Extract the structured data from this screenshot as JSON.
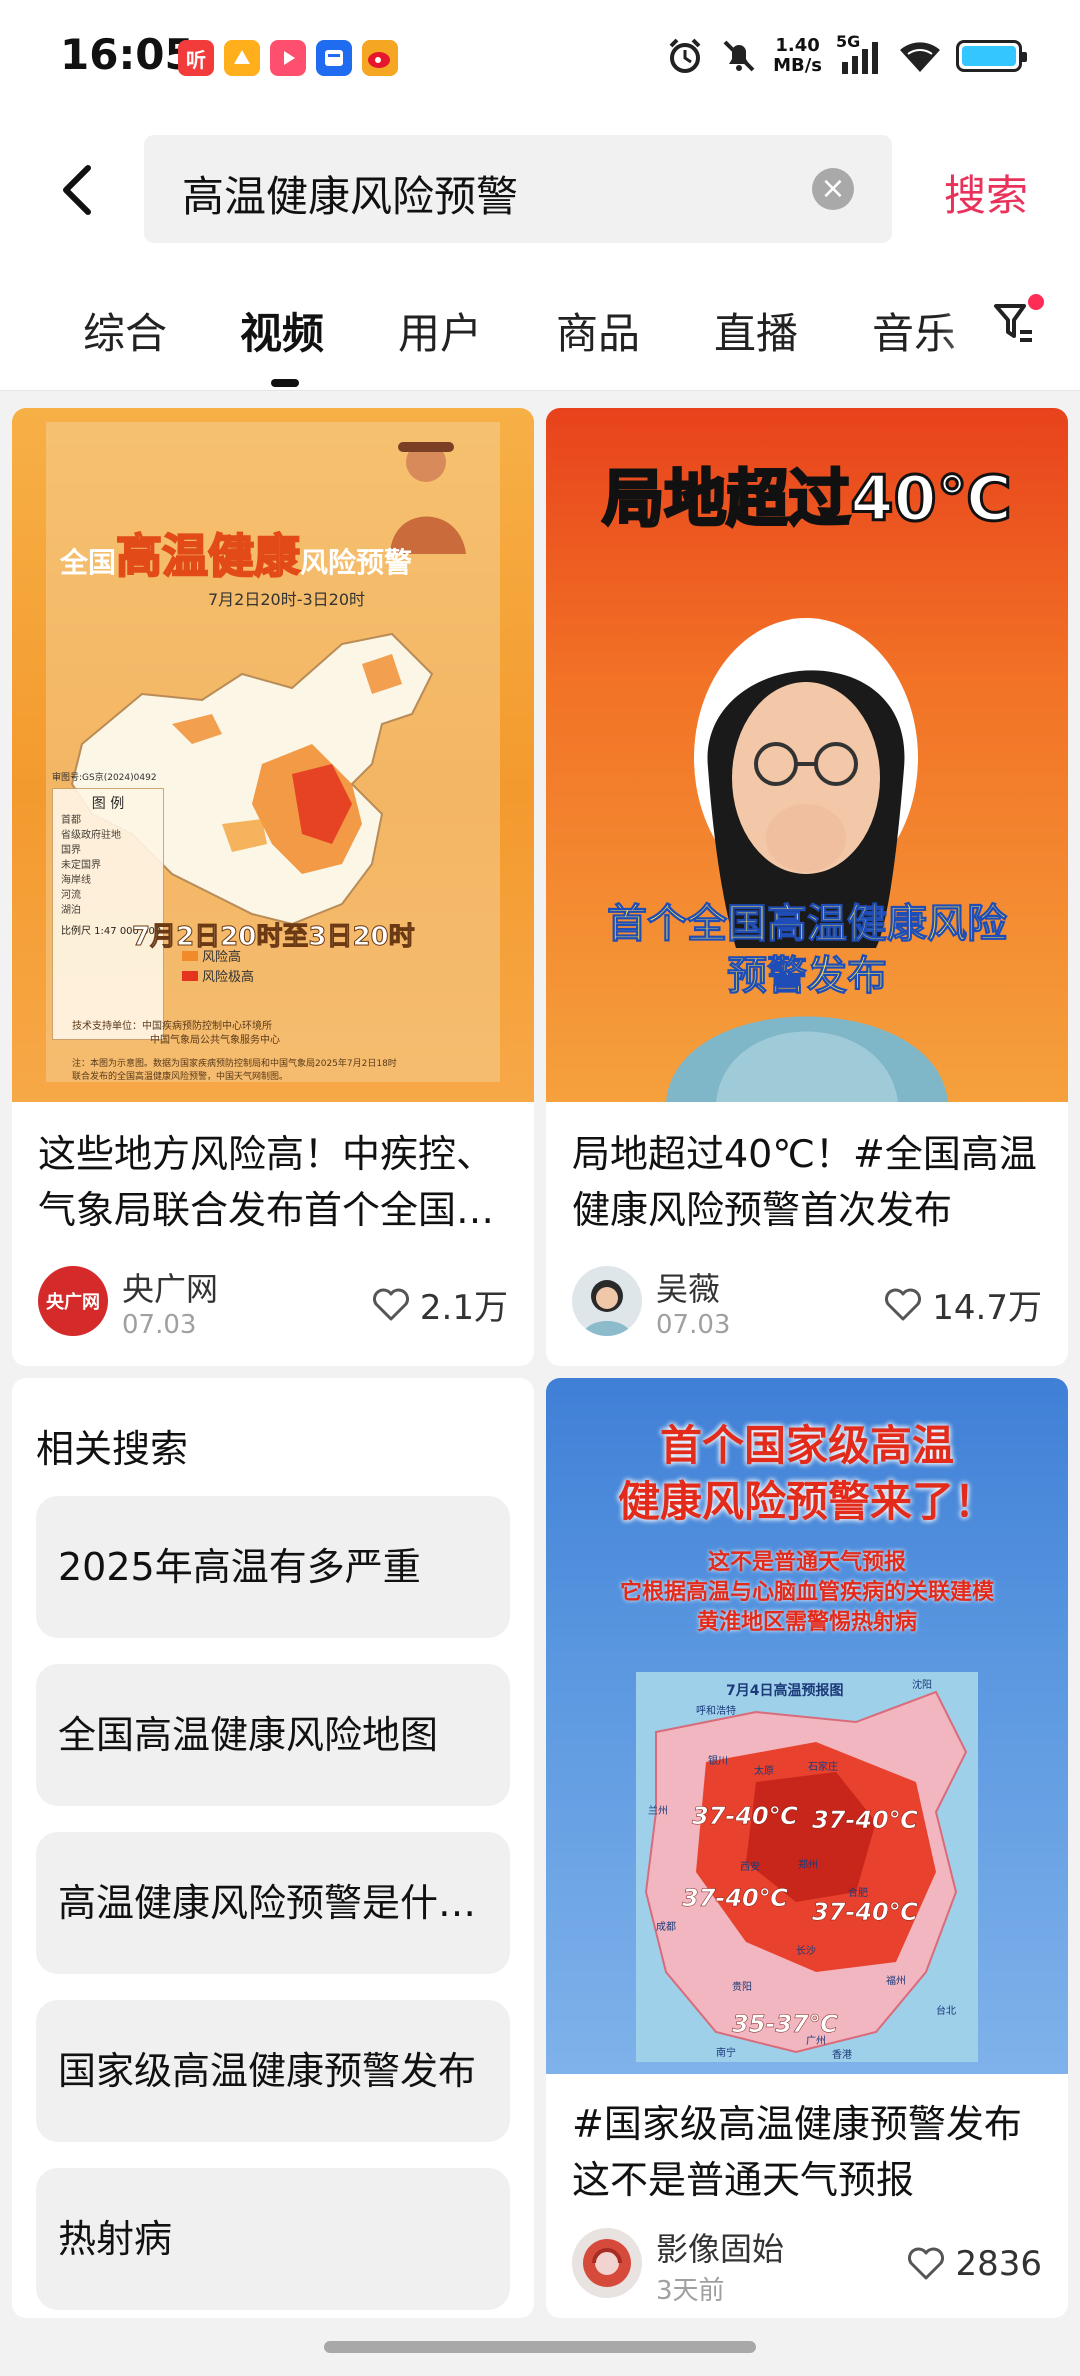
{
  "status_bar": {
    "time": "16:05",
    "apps": [
      {
        "icon": "ting-app-icon",
        "label": "听",
        "color": "#f23c3c"
      },
      {
        "icon": "orange-app-icon",
        "label": "",
        "color": "#ffae1c"
      },
      {
        "icon": "video-app-icon",
        "label": "",
        "color": "#ff4f6e"
      },
      {
        "icon": "news-app-icon",
        "label": "",
        "color": "#1f6cf0"
      },
      {
        "icon": "weibo-icon",
        "label": "",
        "color": "#f5a623"
      }
    ],
    "net_speed_value": "1.40",
    "net_speed_unit": "MB/s",
    "signal_label": "5G"
  },
  "search": {
    "query": "高温健康风险预警",
    "button_label": "搜索"
  },
  "tabs": [
    {
      "label": "综合"
    },
    {
      "label": "视频"
    },
    {
      "label": "用户"
    },
    {
      "label": "商品"
    },
    {
      "label": "直播"
    },
    {
      "label": "音乐"
    }
  ],
  "cards": [
    {
      "title": "这些地方风险高！中疾控、气象局联合发布首个全国高温健康风险预警",
      "author": "央广网",
      "avatar_text": "央广网",
      "date": "07.03",
      "likes": "2.1万",
      "thumb": {
        "heading_a": "全国",
        "heading_b": "高温健康",
        "heading_c": "风险预警",
        "time_range": "7月2日20时-3日20时",
        "map_caption": "7月2日20时至3日20时",
        "legend_title": "图 例",
        "legend_items": [
          "首都",
          "省级政府驻地",
          "国界",
          "未定国界",
          "海岸线",
          "河流",
          "湖泊"
        ],
        "risk_high": "风险高",
        "risk_very_high": "风险极高",
        "scale": "比例尺 1:47 000 000",
        "review_no": "审图号:GS京(2024)0492",
        "support_a": "技术支持单位：中国疾病预防控制中心环境所",
        "support_b": "中国气象局公共气象服务中心",
        "note_a": "注：本图为示意图。数据为国家疾病预防控制局和中国气象局2025年7月2日18时",
        "note_b": "联合发布的全国高温健康风险预警，中国天气网制图。"
      }
    },
    {
      "title": "局地超过40℃！#全国高温健康风险预警首次发布",
      "author": "吴薇",
      "date": "07.03",
      "likes": "14.7万",
      "thumb": {
        "headline": "局地超过40℃",
        "caption_a": "首个全国高温健康风险",
        "caption_b": "预警发布"
      }
    },
    {
      "title": "#国家级高温健康预警发布 这不是普通天气预报",
      "author": "影像固始",
      "date": "3天前",
      "likes": "2836",
      "thumb": {
        "headline_a": "首个国家级高温",
        "headline_b": "健康风险预警来了！",
        "sub_a": "这不是普通天气预报",
        "sub_b": "它根据高温与心脑血管疾病的关联建模",
        "sub_c": "黄淮地区需警惕热射病",
        "map_title": "7月4日高温预报图",
        "temps": [
          "37-40℃",
          "37-40℃",
          "37-40℃",
          "37-40℃",
          "35-37℃"
        ],
        "city_labels": [
          "沈阳",
          "呼和浩特",
          "太原",
          "石家庄",
          "西安",
          "郑州",
          "合肥",
          "成都",
          "长沙",
          "福州",
          "贵阳",
          "台北",
          "南宁",
          "广州",
          "香港",
          "兰州",
          "银川"
        ]
      }
    }
  ],
  "related": {
    "title": "相关搜索",
    "items": [
      "2025年高温有多严重",
      "全国高温健康风险地图",
      "高温健康风险预警是什么意思",
      "国家级高温健康预警发布",
      "热射病"
    ]
  }
}
